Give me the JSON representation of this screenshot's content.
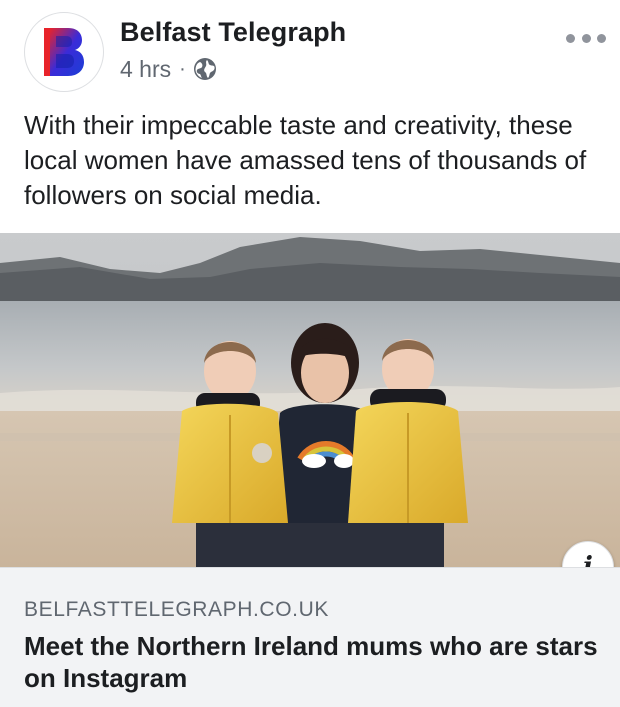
{
  "post": {
    "page_name": "Belfast Telegraph",
    "timestamp": "4 hrs",
    "separator": "·",
    "privacy_icon": "globe-icon",
    "more_icon": "more-options-icon",
    "text": "With their impeccable taste and creativity, these local women have amassed tens of thousands of followers on social media."
  },
  "avatar": {
    "letter": "B",
    "colors": [
      "#e8232a",
      "#1b3fd6",
      "#7a1fb4"
    ]
  },
  "link_preview": {
    "image_alt": "Mother with twin daughters in yellow coats on a beach",
    "info_icon": "i",
    "domain": "BELFASTTELEGRAPH.CO.UK",
    "title": "Meet the Northern Ireland mums who are stars on Instagram"
  }
}
